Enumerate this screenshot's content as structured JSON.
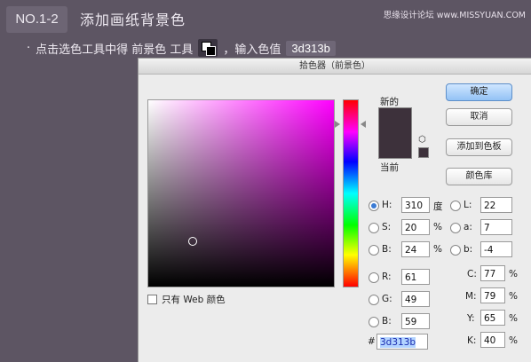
{
  "header": {
    "step": "NO.1-2",
    "title": "添加画纸背景色",
    "watermark": "思缘设计论坛 www.MISSYUAN.COM"
  },
  "instruction": {
    "bullet": "·",
    "text_before": "点击选色工具中得 前景色 工具",
    "text_after": "，输入色值",
    "hex_value": "3d313b"
  },
  "dialog": {
    "title": "拾色器（前景色）",
    "new_label": "新的",
    "current_label": "当前",
    "new_color": "#3d313b",
    "current_color": "#3d313b",
    "web_only_label": "只有 Web 颜色",
    "buttons": {
      "ok": "确定",
      "cancel": "取消",
      "add_swatch": "添加到色板",
      "libraries": "颜色库"
    },
    "hsb": {
      "h_label": "H:",
      "h": "310",
      "h_unit": "度",
      "s_label": "S:",
      "s": "20",
      "s_unit": "%",
      "b_label": "B:",
      "b": "24",
      "b_unit": "%"
    },
    "rgb": {
      "r_label": "R:",
      "r": "61",
      "g_label": "G:",
      "g": "49",
      "b_label": "B:",
      "b": "59"
    },
    "lab": {
      "l_label": "L:",
      "l": "22",
      "a_label": "a:",
      "a": "7",
      "b_label": "b:",
      "b": "-4"
    },
    "cmyk": {
      "c_label": "C:",
      "c": "77",
      "m_label": "M:",
      "m": "79",
      "y_label": "Y:",
      "y": "65",
      "k_label": "K:",
      "k": "40",
      "unit": "%"
    },
    "hex_label": "#",
    "hex": "3d313b"
  }
}
